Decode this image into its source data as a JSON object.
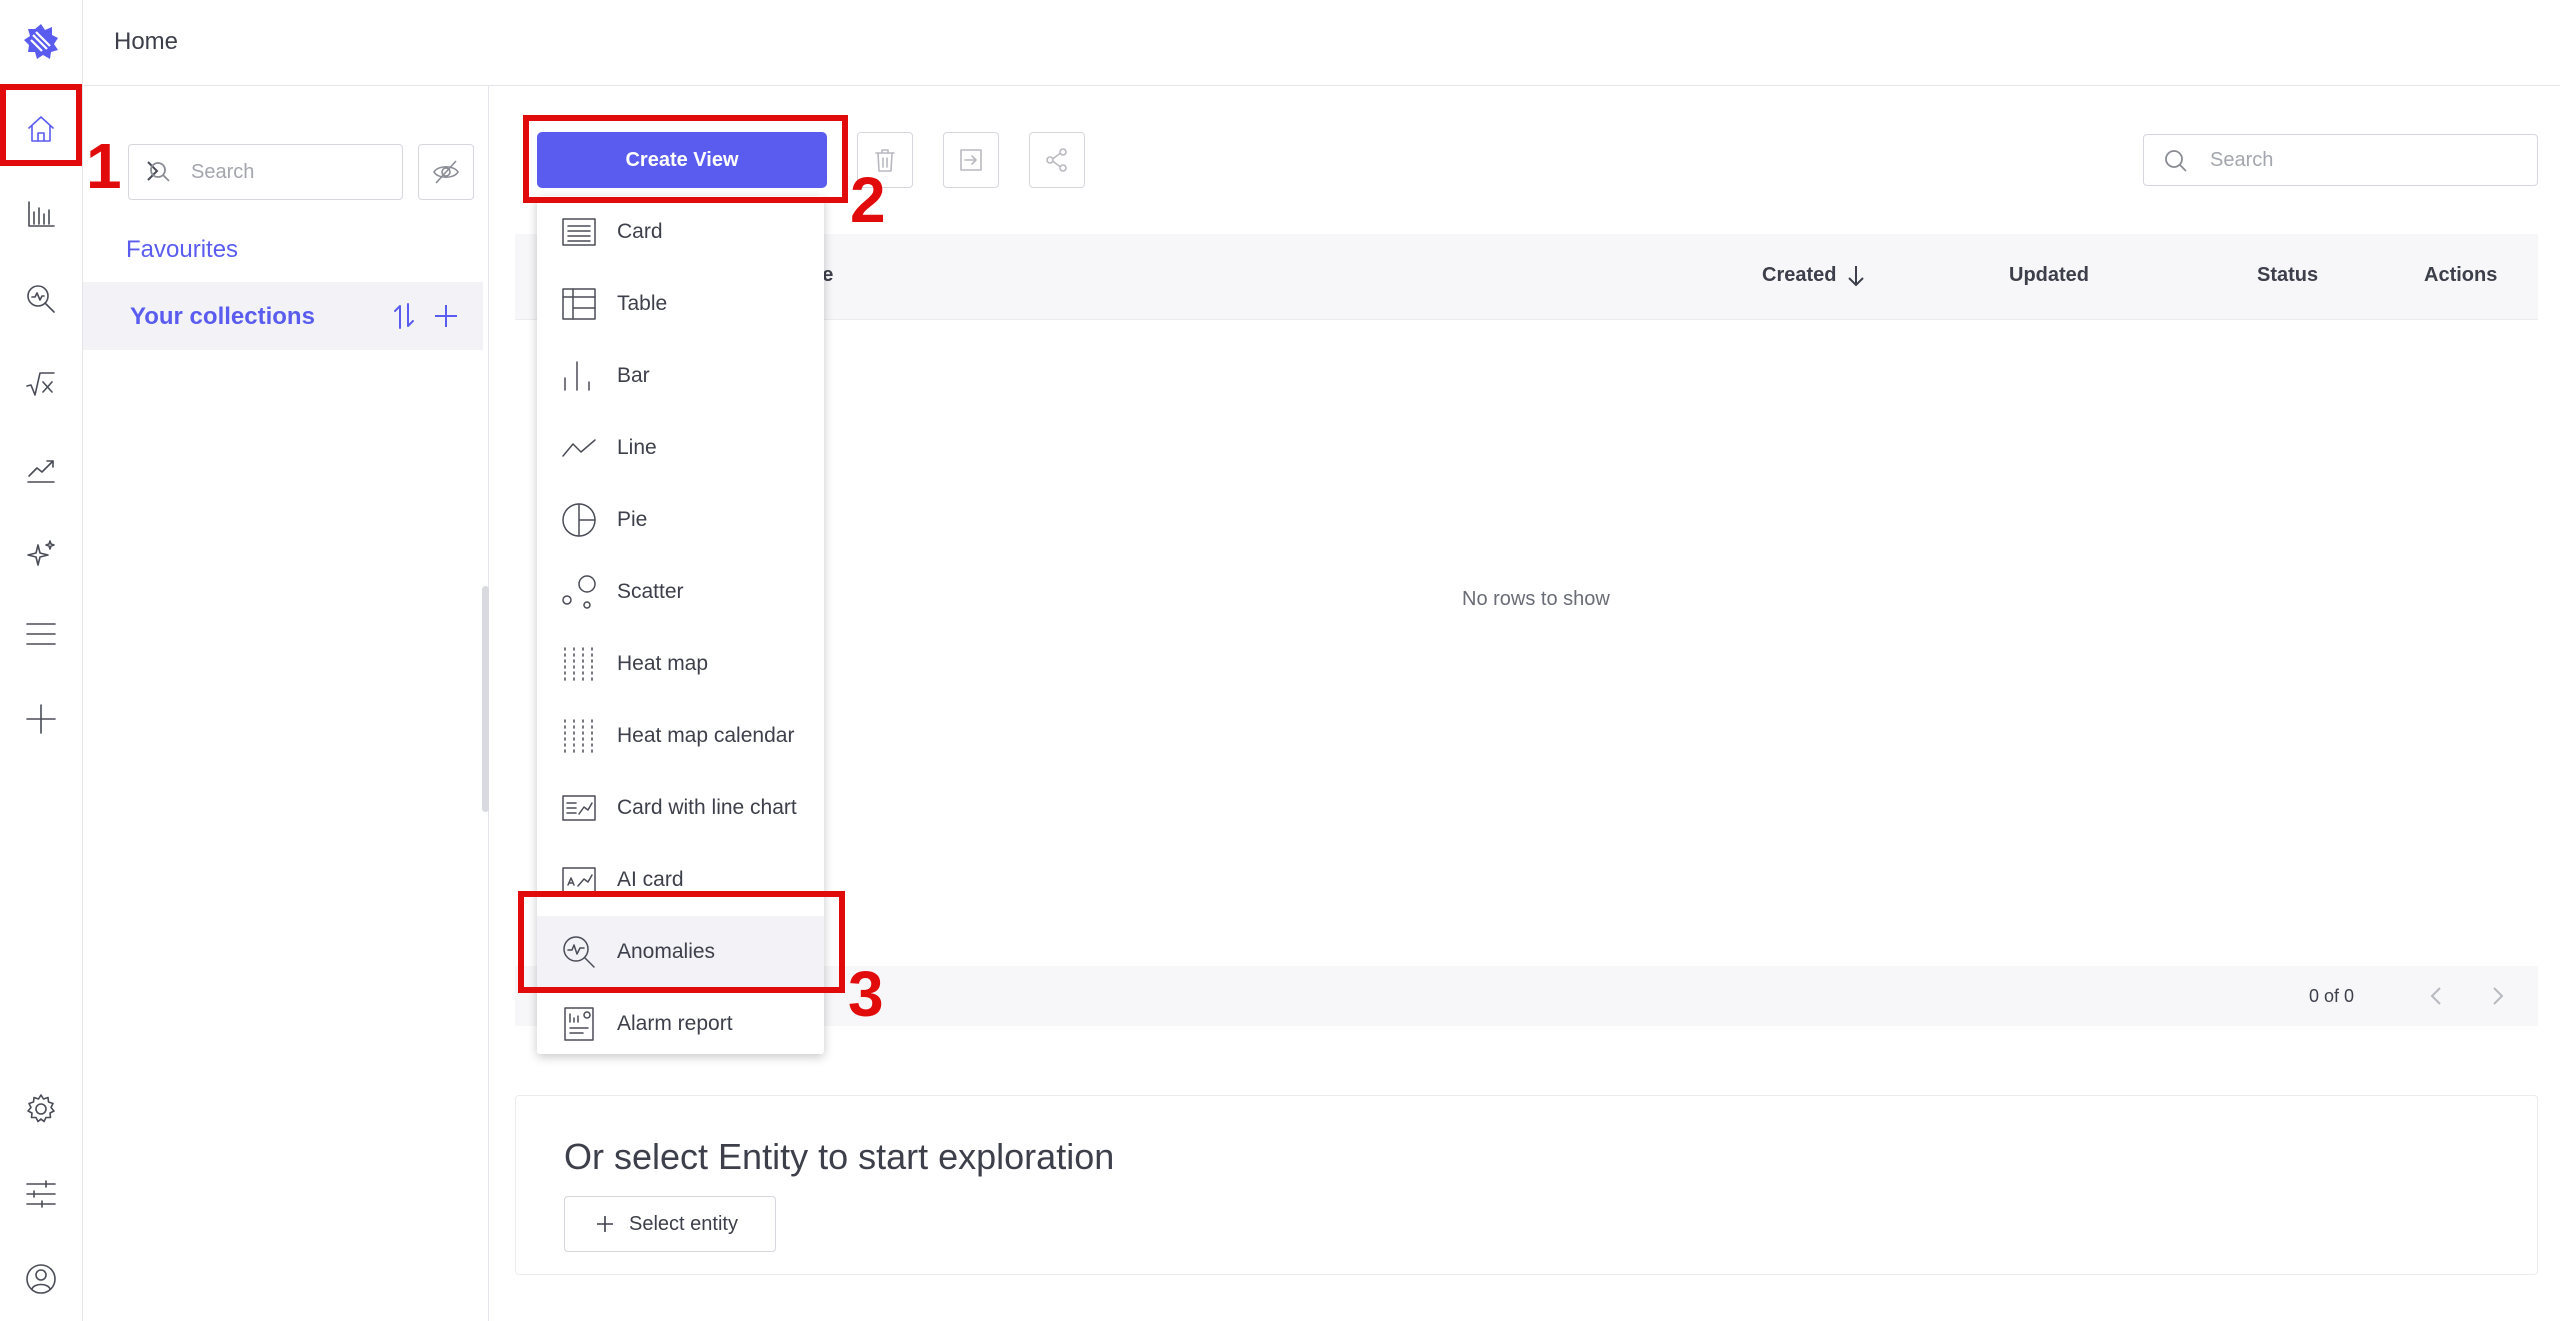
{
  "breadcrumb": "Home",
  "colors": {
    "accent": "#5a5cf0",
    "annotation": "#e10b0b"
  },
  "rail": {
    "items": [
      {
        "icon": "home-icon",
        "active": true
      },
      {
        "icon": "bar-chart-icon"
      },
      {
        "icon": "anomaly-search-icon"
      },
      {
        "icon": "formula-icon"
      },
      {
        "icon": "trend-line-icon"
      },
      {
        "icon": "sparkle-icon"
      },
      {
        "icon": "menu-lines-icon"
      },
      {
        "icon": "plus-icon"
      },
      {
        "icon": "gear-icon"
      },
      {
        "icon": "sliders-icon"
      },
      {
        "icon": "user-icon"
      }
    ]
  },
  "panel": {
    "search_placeholder": "Search",
    "favourites": "Favourites",
    "collections": "Your collections"
  },
  "toolbar": {
    "create_view": "Create View",
    "search_placeholder": "Search"
  },
  "grid": {
    "columns": [
      "ne",
      "Created",
      "Updated",
      "Status",
      "Actions"
    ],
    "empty": "No rows to show",
    "pagination": "0 of 0"
  },
  "menu": {
    "items": [
      {
        "label": "Card",
        "icon": "card-icon"
      },
      {
        "label": "Table",
        "icon": "table-icon"
      },
      {
        "label": "Bar",
        "icon": "bar-icon"
      },
      {
        "label": "Line",
        "icon": "line-icon"
      },
      {
        "label": "Pie",
        "icon": "pie-icon"
      },
      {
        "label": "Scatter",
        "icon": "scatter-icon"
      },
      {
        "label": "Heat map",
        "icon": "heatmap-icon"
      },
      {
        "label": "Heat map calendar",
        "icon": "heatmap-calendar-icon"
      },
      {
        "label": "Card with line chart",
        "icon": "card-line-chart-icon"
      },
      {
        "label": "AI card",
        "icon": "ai-card-icon"
      },
      {
        "label": "Anomalies",
        "icon": "anomalies-icon",
        "highlighted": true
      },
      {
        "label": "Alarm report",
        "icon": "alarm-report-icon"
      }
    ]
  },
  "entity": {
    "title": "Or select Entity to start exploration",
    "button": "Select entity"
  },
  "annotations": [
    "1",
    "2",
    "3"
  ]
}
